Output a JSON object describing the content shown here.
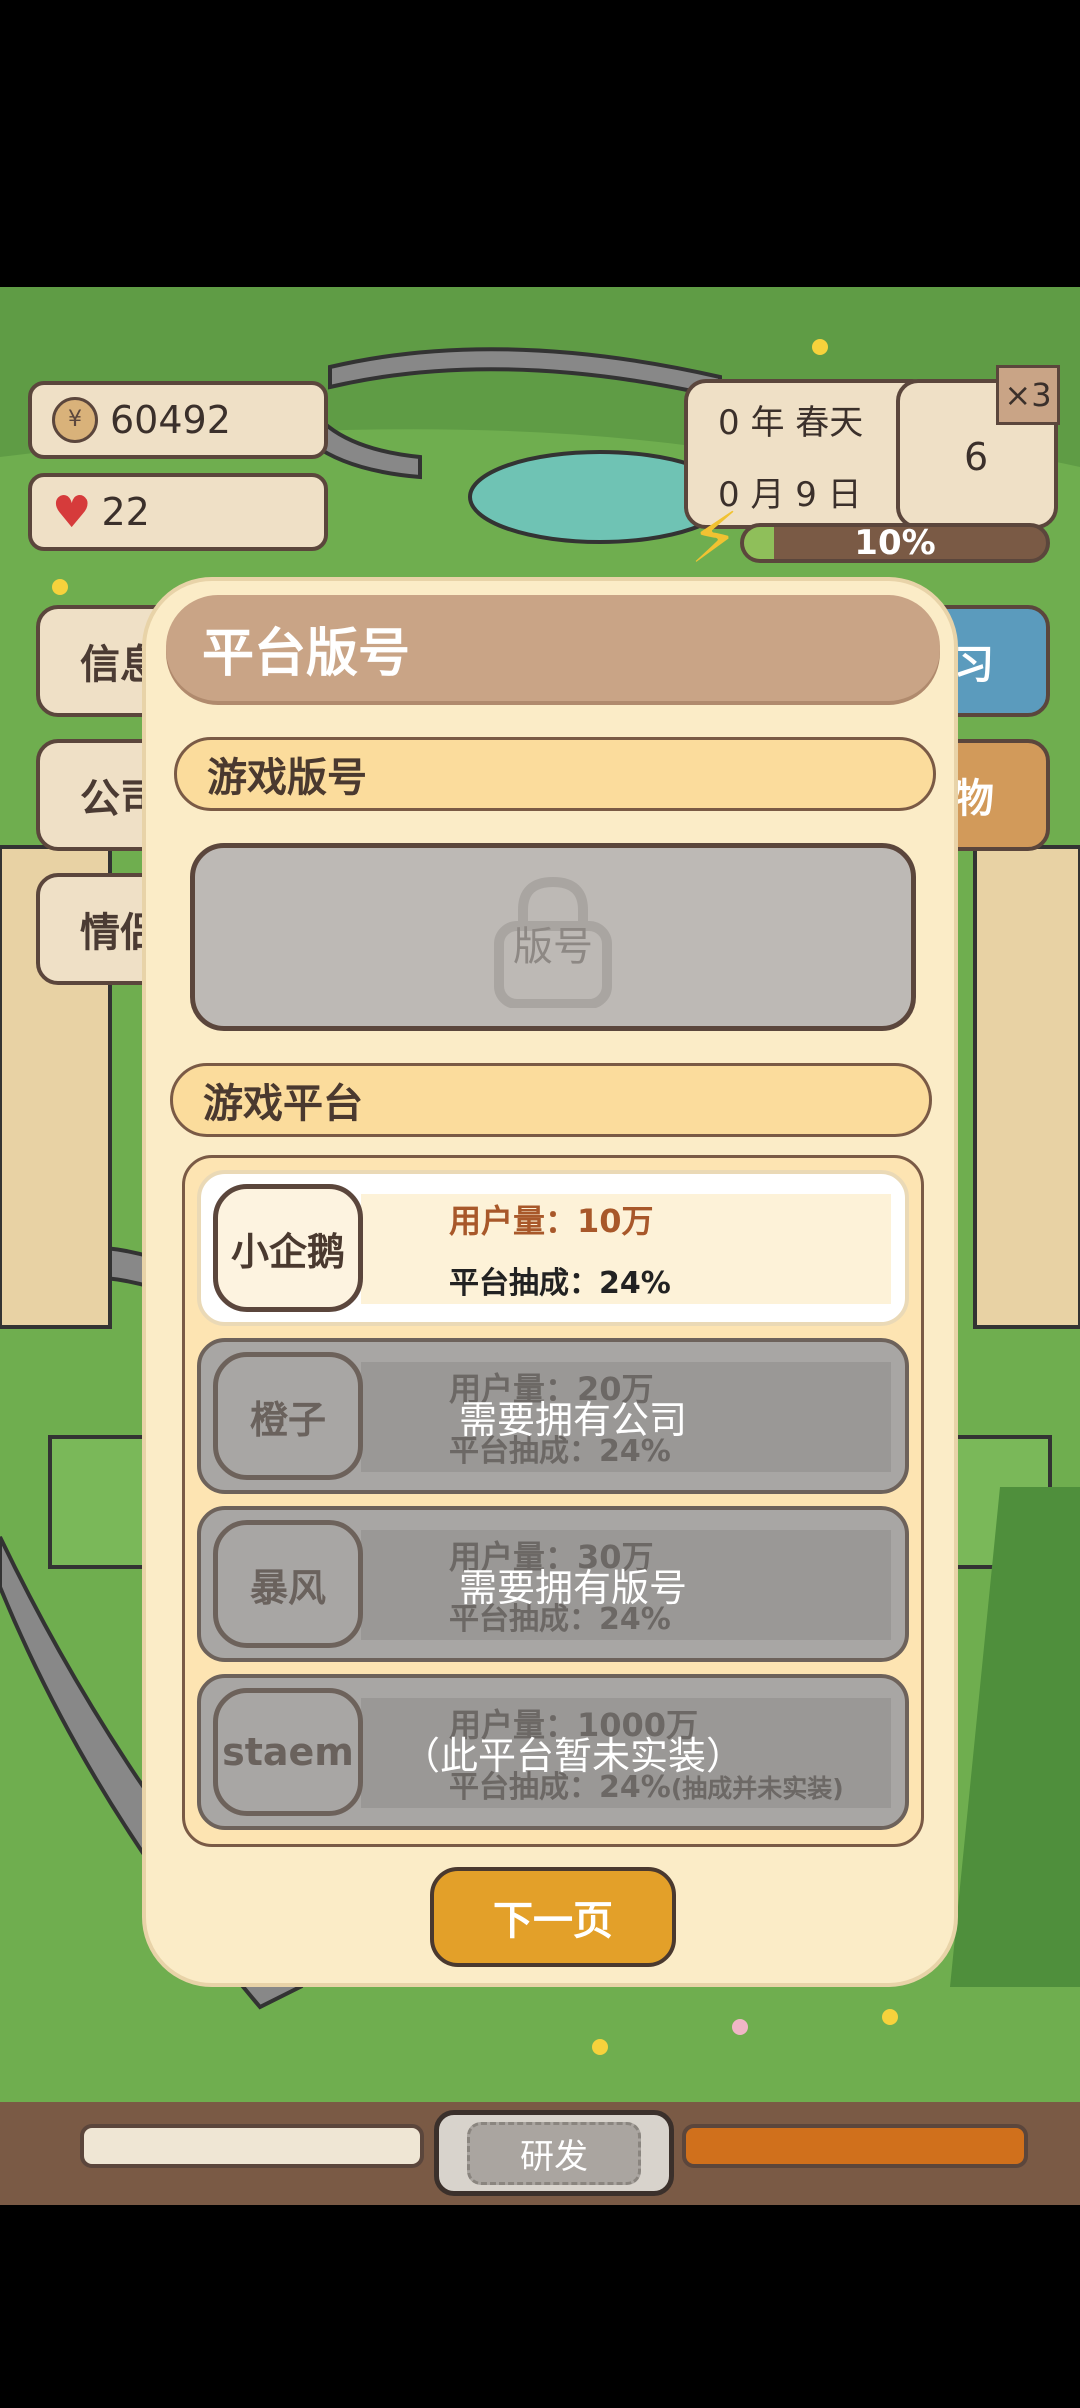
{
  "hud": {
    "money": "60492",
    "hearts": "22",
    "date_year_season": "0 年 春天",
    "date_month_day": "0 月 9 日",
    "day_counter": "6",
    "multiplier_label": "×3",
    "energy_percent_text": "10%",
    "energy_fraction": 0.1
  },
  "left_menu": [
    {
      "label": "信息"
    },
    {
      "label": "公司"
    },
    {
      "label": "情侣"
    }
  ],
  "right_menu": [
    {
      "label": "学习",
      "color": "#5b9bbd"
    },
    {
      "label": "购物",
      "color": "#d29a5a"
    }
  ],
  "modal": {
    "title": "平台版号",
    "section_license": "游戏版号",
    "license_placeholder": "版号",
    "section_platform": "游戏平台",
    "platforms": [
      {
        "name": "小企鹅",
        "users": "用户量：10万",
        "cut": "平台抽成：24%",
        "cut_note": "",
        "locked": false,
        "lock_text": ""
      },
      {
        "name": "橙子",
        "users": "用户量：20万",
        "cut": "平台抽成：24%",
        "cut_note": "",
        "locked": true,
        "lock_text": "需要拥有公司"
      },
      {
        "name": "暴风",
        "users": "用户量：30万",
        "cut": "平台抽成：24%",
        "cut_note": "",
        "locked": true,
        "lock_text": "需要拥有版号"
      },
      {
        "name": "staem",
        "users": "用户量：1000万",
        "cut": "平台抽成：24%",
        "cut_note": "(抽成并未实装)",
        "locked": true,
        "lock_text": "（此平台暂未实装）"
      }
    ],
    "next_button": "下一页"
  },
  "bottom_bar": {
    "center_label": "研发"
  },
  "colors": {
    "accent_orange": "#e3a029",
    "panel_cream": "#fbecc7",
    "title_brown": "#c9a486"
  }
}
